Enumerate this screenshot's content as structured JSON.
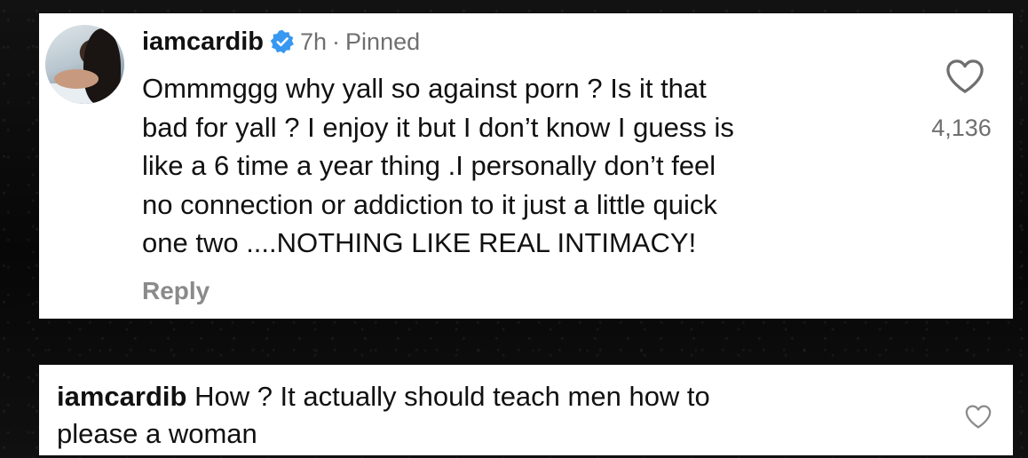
{
  "comment": {
    "username": "iamcardib",
    "time": "7h",
    "separator": "·",
    "pinned_label": "Pinned",
    "text": "Ommmggg why yall so against porn ? Is it that bad for yall ? I enjoy it but I don’t know I guess is like a 6 time a year thing .I personally don’t feel no connection or addiction to it just a little quick one two ....NOTHING LIKE REAL INTIMACY!",
    "lines": [
      "Ommmggg why yall so against porn ? Is it that",
      "bad for yall ? I enjoy it but I don’t know I guess is",
      "like a 6 time a year thing .I personally don’t feel",
      "no connection or addiction to it just a little quick",
      "one two ....NOTHING LIKE REAL INTIMACY!"
    ],
    "reply_label": "Reply",
    "like_count": "4,136",
    "verified_icon": "verified-badge-icon",
    "like_icon": "heart-outline-icon"
  },
  "reply": {
    "username": "iamcardib",
    "lines": [
      "How ? It actually should teach men how to",
      "please a woman"
    ],
    "like_icon": "heart-outline-icon"
  },
  "colors": {
    "card_background": "#ffffff",
    "verified_blue": "#3897f0",
    "muted_text": "#6f6f6f",
    "reply_label": "#8a8a8a",
    "page_background": "#0b0b0b"
  }
}
